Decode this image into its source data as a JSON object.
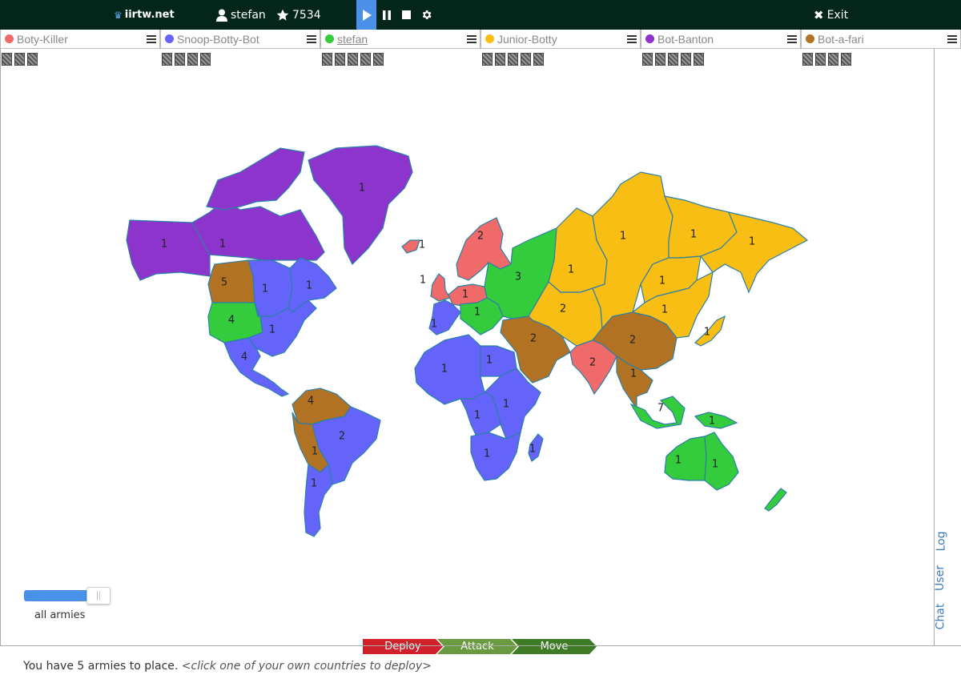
{
  "topbar": {
    "brand": "iirtw.net",
    "user_name": "stefan",
    "score": "7534",
    "exit_label": "Exit"
  },
  "players": [
    {
      "name": "Boty-Killer",
      "color": "#f06a6a",
      "cards": 3
    },
    {
      "name": "Snoop-Botty-Bot",
      "color": "#6464fa",
      "cards": 4
    },
    {
      "name": "stefan",
      "color": "#34cc3c",
      "cards": 5,
      "current": true
    },
    {
      "name": "Junior-Botty",
      "color": "#f8be14",
      "cards": 5
    },
    {
      "name": "Bot-Banton",
      "color": "#8c34cc",
      "cards": 5
    },
    {
      "name": "Bot-a-fari",
      "color": "#b27224",
      "cards": 4
    }
  ],
  "slider": {
    "label": "all armies",
    "value": 0.8
  },
  "phases": {
    "deploy": "Deploy",
    "attack": "Attack",
    "move": "Move",
    "active": "deploy"
  },
  "status": {
    "text": "You have 5 armies to place.",
    "hint": "<click one of your own countries to deploy>"
  },
  "side_tabs": {
    "log": "Log",
    "user": "User",
    "chat": "Chat"
  },
  "territories": [
    {
      "name": "alaska",
      "owner": "Bot-Banton",
      "armies": "1"
    },
    {
      "name": "northwest-territory",
      "owner": "Bot-Banton",
      "armies": "1"
    },
    {
      "name": "greenland",
      "owner": "Bot-Banton",
      "armies": "1"
    },
    {
      "name": "alberta",
      "owner": "Bot-a-fari",
      "armies": "5"
    },
    {
      "name": "ontario",
      "owner": "Snoop-Botty-Bot",
      "armies": "1"
    },
    {
      "name": "quebec",
      "owner": "Snoop-Botty-Bot",
      "armies": "1"
    },
    {
      "name": "western-us",
      "owner": "stefan",
      "armies": "4"
    },
    {
      "name": "eastern-us",
      "owner": "Snoop-Botty-Bot",
      "armies": "1"
    },
    {
      "name": "central-america",
      "owner": "Snoop-Botty-Bot",
      "armies": "4"
    },
    {
      "name": "venezuela",
      "owner": "Bot-a-fari",
      "armies": "4"
    },
    {
      "name": "brazil",
      "owner": "Snoop-Botty-Bot",
      "armies": "2"
    },
    {
      "name": "peru",
      "owner": "Bot-a-fari",
      "armies": "1"
    },
    {
      "name": "argentina",
      "owner": "Snoop-Botty-Bot",
      "armies": "1"
    },
    {
      "name": "iceland",
      "owner": "Boty-Killer",
      "armies": "1"
    },
    {
      "name": "great-britain",
      "owner": "Boty-Killer",
      "armies": "1"
    },
    {
      "name": "scandinavia",
      "owner": "Boty-Killer",
      "armies": "2"
    },
    {
      "name": "northern-europe",
      "owner": "Boty-Killer",
      "armies": "1"
    },
    {
      "name": "western-europe",
      "owner": "Snoop-Botty-Bot",
      "armies": "1"
    },
    {
      "name": "southern-europe",
      "owner": "stefan",
      "armies": "1"
    },
    {
      "name": "ukraine",
      "owner": "stefan",
      "armies": "3"
    },
    {
      "name": "north-africa",
      "owner": "Snoop-Botty-Bot",
      "armies": "1"
    },
    {
      "name": "egypt",
      "owner": "Snoop-Botty-Bot",
      "armies": "1"
    },
    {
      "name": "east-africa",
      "owner": "Snoop-Botty-Bot",
      "armies": "1"
    },
    {
      "name": "congo",
      "owner": "Snoop-Botty-Bot",
      "armies": "1"
    },
    {
      "name": "south-africa",
      "owner": "Snoop-Botty-Bot",
      "armies": "1"
    },
    {
      "name": "madagascar",
      "owner": "Snoop-Botty-Bot",
      "armies": "1"
    },
    {
      "name": "ural",
      "owner": "Junior-Botty",
      "armies": "1"
    },
    {
      "name": "afghanistan",
      "owner": "Junior-Botty",
      "armies": "2"
    },
    {
      "name": "middle-east",
      "owner": "Bot-a-fari",
      "armies": "2"
    },
    {
      "name": "india",
      "owner": "Boty-Killer",
      "armies": "2"
    },
    {
      "name": "china",
      "owner": "Bot-a-fari",
      "armies": "2"
    },
    {
      "name": "siam",
      "owner": "Bot-a-fari",
      "armies": "1"
    },
    {
      "name": "siberia",
      "owner": "Junior-Botty",
      "armies": "1"
    },
    {
      "name": "yakutsk",
      "owner": "Junior-Botty",
      "armies": "1"
    },
    {
      "name": "kamchatka",
      "owner": "Junior-Botty",
      "armies": "1"
    },
    {
      "name": "irkutsk",
      "owner": "Junior-Botty",
      "armies": "1"
    },
    {
      "name": "mongolia",
      "owner": "Junior-Botty",
      "armies": "1"
    },
    {
      "name": "japan",
      "owner": "Junior-Botty",
      "armies": "1"
    },
    {
      "name": "indonesia",
      "owner": "stefan",
      "armies": "7"
    },
    {
      "name": "new-guinea",
      "owner": "stefan",
      "armies": "1"
    },
    {
      "name": "western-australia",
      "owner": "stefan",
      "armies": "1"
    },
    {
      "name": "eastern-australia",
      "owner": "stefan",
      "armies": "1"
    }
  ]
}
